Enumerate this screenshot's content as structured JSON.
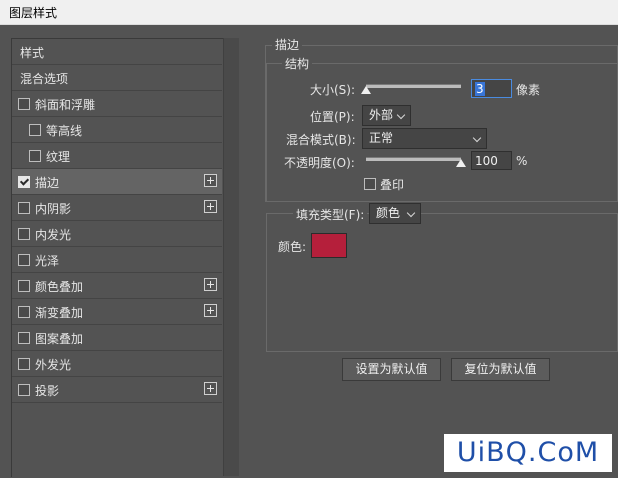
{
  "window": {
    "title": "图层样式"
  },
  "left_list": {
    "items": [
      {
        "label": "样式",
        "checkbox": false,
        "checked": false,
        "plus": false,
        "indent": 0
      },
      {
        "label": "混合选项",
        "checkbox": false,
        "checked": false,
        "plus": false,
        "indent": 0
      },
      {
        "label": "斜面和浮雕",
        "checkbox": true,
        "checked": false,
        "plus": false,
        "indent": 0
      },
      {
        "label": "等高线",
        "checkbox": true,
        "checked": false,
        "plus": false,
        "indent": 1
      },
      {
        "label": "纹理",
        "checkbox": true,
        "checked": false,
        "plus": false,
        "indent": 1
      },
      {
        "label": "描边",
        "checkbox": true,
        "checked": true,
        "plus": true,
        "indent": 0,
        "selected": true
      },
      {
        "label": "内阴影",
        "checkbox": true,
        "checked": false,
        "plus": true,
        "indent": 0
      },
      {
        "label": "内发光",
        "checkbox": true,
        "checked": false,
        "plus": false,
        "indent": 0
      },
      {
        "label": "光泽",
        "checkbox": true,
        "checked": false,
        "plus": false,
        "indent": 0
      },
      {
        "label": "颜色叠加",
        "checkbox": true,
        "checked": false,
        "plus": true,
        "indent": 0
      },
      {
        "label": "渐变叠加",
        "checkbox": true,
        "checked": false,
        "plus": true,
        "indent": 0
      },
      {
        "label": "图案叠加",
        "checkbox": true,
        "checked": false,
        "plus": false,
        "indent": 0
      },
      {
        "label": "外发光",
        "checkbox": true,
        "checked": false,
        "plus": false,
        "indent": 0
      },
      {
        "label": "投影",
        "checkbox": true,
        "checked": false,
        "plus": true,
        "indent": 0
      }
    ]
  },
  "stroke": {
    "section_title": "描边",
    "structure_title": "结构",
    "size_label": "大小(S):",
    "size_value": "3",
    "size_unit": "像素",
    "size_slider_fraction": 0.0,
    "position_label": "位置(P):",
    "position_value": "外部",
    "blend_label": "混合模式(B):",
    "blend_value": "正常",
    "opacity_label": "不透明度(O):",
    "opacity_value": "100",
    "opacity_unit": "%",
    "opacity_slider_fraction": 1.0,
    "overprint_label": "叠印",
    "overprint_checked": false,
    "fill_type_label": "填充类型(F):",
    "fill_type_value": "颜色",
    "color_label": "颜色:",
    "color_value": "#b51f3b"
  },
  "buttons": {
    "make_default": "设置为默认值",
    "reset_default": "复位为默认值"
  },
  "watermark": {
    "text": "UiBQ.CoM"
  }
}
